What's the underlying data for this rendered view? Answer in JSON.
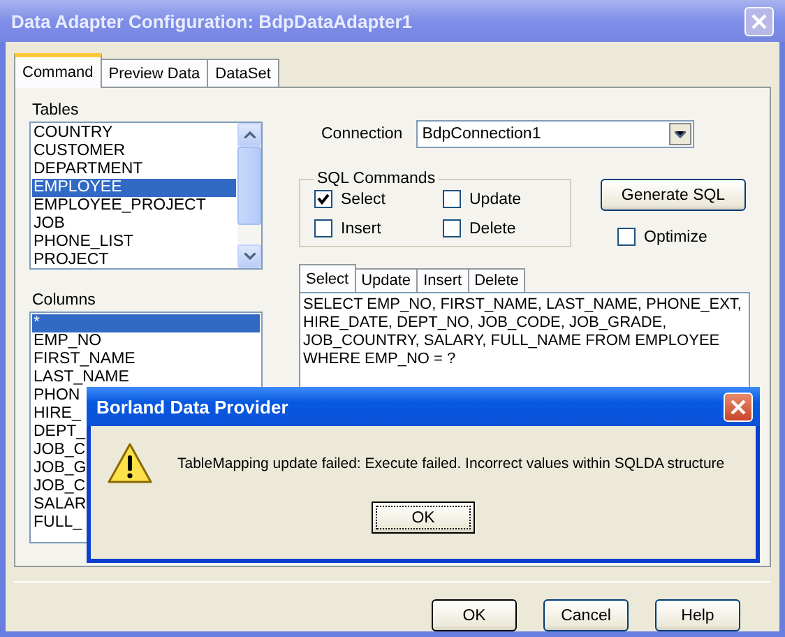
{
  "window": {
    "title": "Data Adapter Configuration: BdpDataAdapter1"
  },
  "tabs": [
    {
      "label": "Command",
      "selected": true
    },
    {
      "label": "Preview Data",
      "selected": false
    },
    {
      "label": "DataSet",
      "selected": false
    }
  ],
  "tables": {
    "label": "Tables",
    "items": [
      {
        "name": "COUNTRY",
        "selected": false
      },
      {
        "name": "CUSTOMER",
        "selected": false
      },
      {
        "name": "DEPARTMENT",
        "selected": false
      },
      {
        "name": "EMPLOYEE",
        "selected": true
      },
      {
        "name": "EMPLOYEE_PROJECT",
        "selected": false
      },
      {
        "name": "JOB",
        "selected": false
      },
      {
        "name": "PHONE_LIST",
        "selected": false
      },
      {
        "name": "PROJECT",
        "selected": false
      }
    ]
  },
  "columns": {
    "label": "Columns",
    "items": [
      {
        "name": "*",
        "selected": true
      },
      {
        "name": "EMP_NO",
        "selected": false
      },
      {
        "name": "FIRST_NAME",
        "selected": false
      },
      {
        "name": "LAST_NAME",
        "selected": false
      },
      {
        "name": "PHON",
        "selected": false
      },
      {
        "name": "HIRE_",
        "selected": false
      },
      {
        "name": "DEPT_",
        "selected": false
      },
      {
        "name": "JOB_C",
        "selected": false
      },
      {
        "name": "JOB_G",
        "selected": false
      },
      {
        "name": "JOB_C",
        "selected": false
      },
      {
        "name": "SALAR",
        "selected": false
      },
      {
        "name": "FULL_",
        "selected": false
      }
    ]
  },
  "connection": {
    "label": "Connection",
    "value": "BdpConnection1"
  },
  "sql_commands": {
    "title": "SQL Commands",
    "options": [
      {
        "label": "Select",
        "checked": true
      },
      {
        "label": "Update",
        "checked": false
      },
      {
        "label": "Insert",
        "checked": false
      },
      {
        "label": "Delete",
        "checked": false
      }
    ]
  },
  "generate_button": "Generate SQL",
  "optimize": {
    "label": "Optimize",
    "checked": false
  },
  "sql_tabs": [
    {
      "label": "Select",
      "selected": true
    },
    {
      "label": "Update",
      "selected": false
    },
    {
      "label": "Insert",
      "selected": false
    },
    {
      "label": "Delete",
      "selected": false
    }
  ],
  "sql_lines": [
    "SELECT EMP_NO, FIRST_NAME, LAST_NAME, PHONE_EXT,",
    "HIRE_DATE, DEPT_NO, JOB_CODE, JOB_GRADE,",
    "JOB_COUNTRY, SALARY, FULL_NAME FROM EMPLOYEE",
    "WHERE EMP_NO = ?"
  ],
  "buttons": [
    "OK",
    "Cancel",
    "Help"
  ],
  "message_box": {
    "title": "Borland Data Provider",
    "message": "TableMapping update failed: Execute failed. Incorrect values within SQLDA structure",
    "button": "OK"
  }
}
